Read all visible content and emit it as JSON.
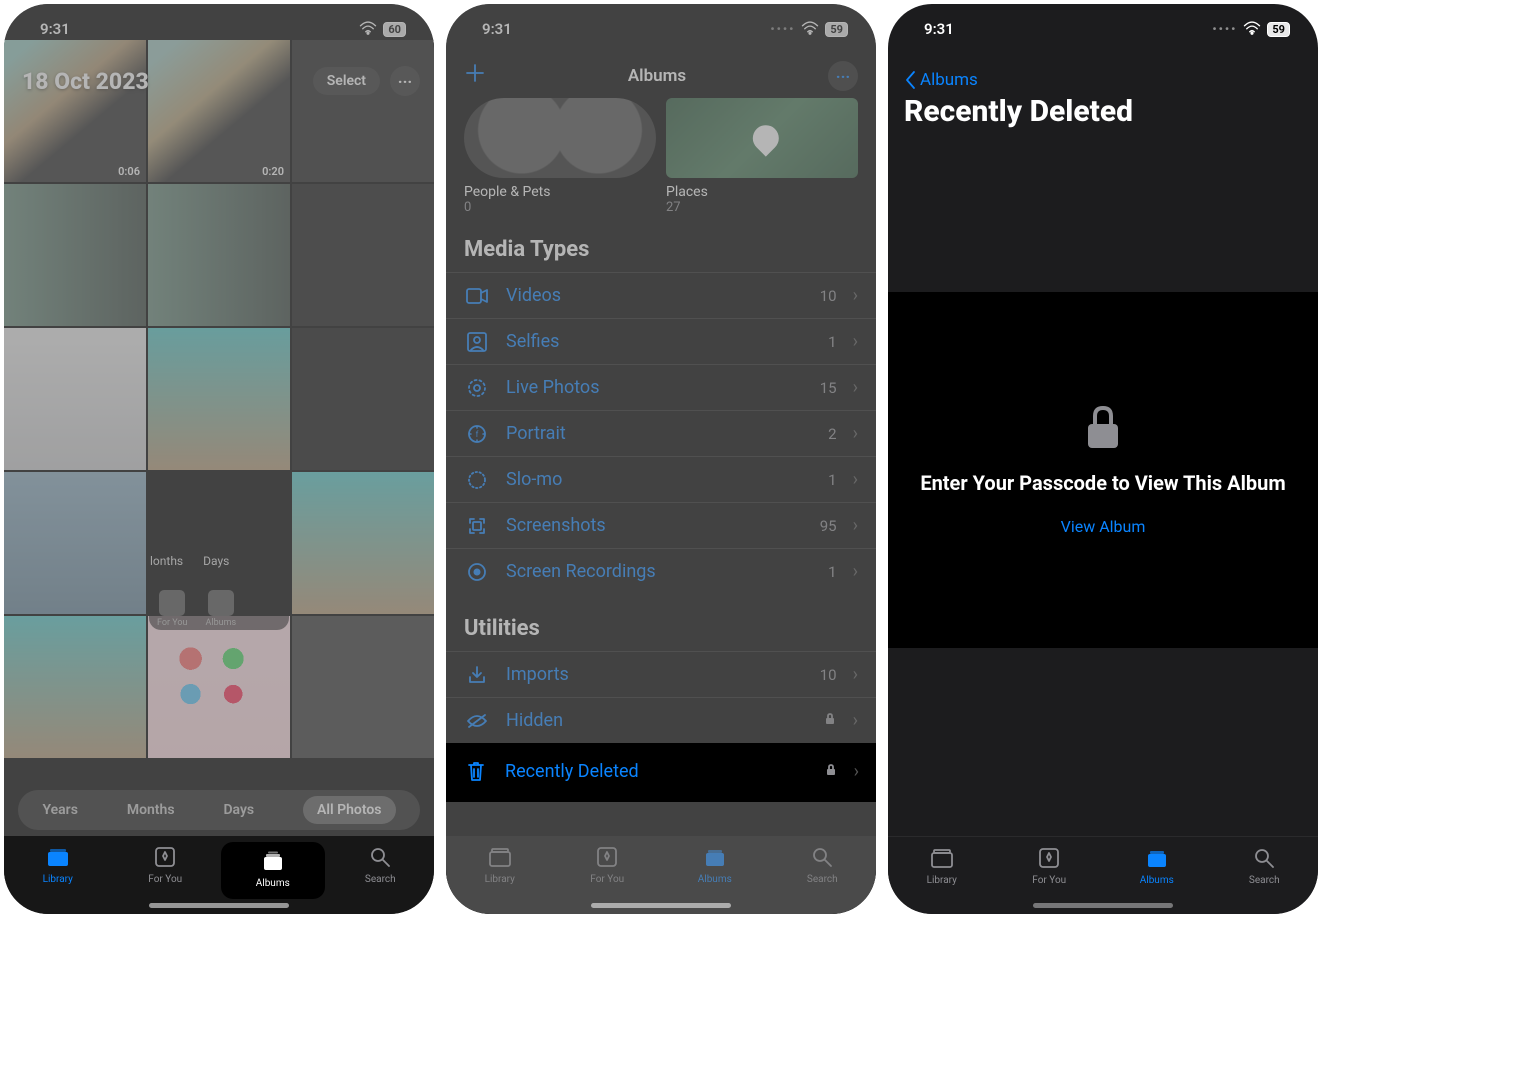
{
  "status": {
    "time": "9:31",
    "battery": "59",
    "battery_alt": "60"
  },
  "screen1": {
    "date": "18 Oct 2023",
    "select": "Select",
    "dur1": "0:06",
    "dur2": "0:20",
    "seg": {
      "years": "Years",
      "months": "Months",
      "days": "Days",
      "all": "All Photos"
    },
    "mini": {
      "seg_months": "lonths",
      "seg_days": "Days",
      "tab_foryou": "For You",
      "tab_albums": "Albums"
    }
  },
  "screen2": {
    "title": "Albums",
    "people_label": "People & Pets",
    "people_count": "0",
    "places_label": "Places",
    "places_count": "27",
    "media_header": "Media Types",
    "utilities_header": "Utilities",
    "rows": {
      "videos": {
        "label": "Videos",
        "count": "10"
      },
      "selfies": {
        "label": "Selfies",
        "count": "1"
      },
      "live": {
        "label": "Live Photos",
        "count": "15"
      },
      "portrait": {
        "label": "Portrait",
        "count": "2"
      },
      "slomo": {
        "label": "Slo-mo",
        "count": "1"
      },
      "screenshots": {
        "label": "Screenshots",
        "count": "95"
      },
      "screenrec": {
        "label": "Screen Recordings",
        "count": "1"
      },
      "imports": {
        "label": "Imports",
        "count": "10"
      },
      "hidden": {
        "label": "Hidden"
      },
      "deleted": {
        "label": "Recently Deleted"
      }
    }
  },
  "screen3": {
    "back": "Albums",
    "title": "Recently Deleted",
    "lock_text": "Enter Your Passcode to View This Album",
    "view_album": "View Album"
  },
  "tabs": {
    "library": "Library",
    "foryou": "For You",
    "albums": "Albums",
    "search": "Search"
  }
}
